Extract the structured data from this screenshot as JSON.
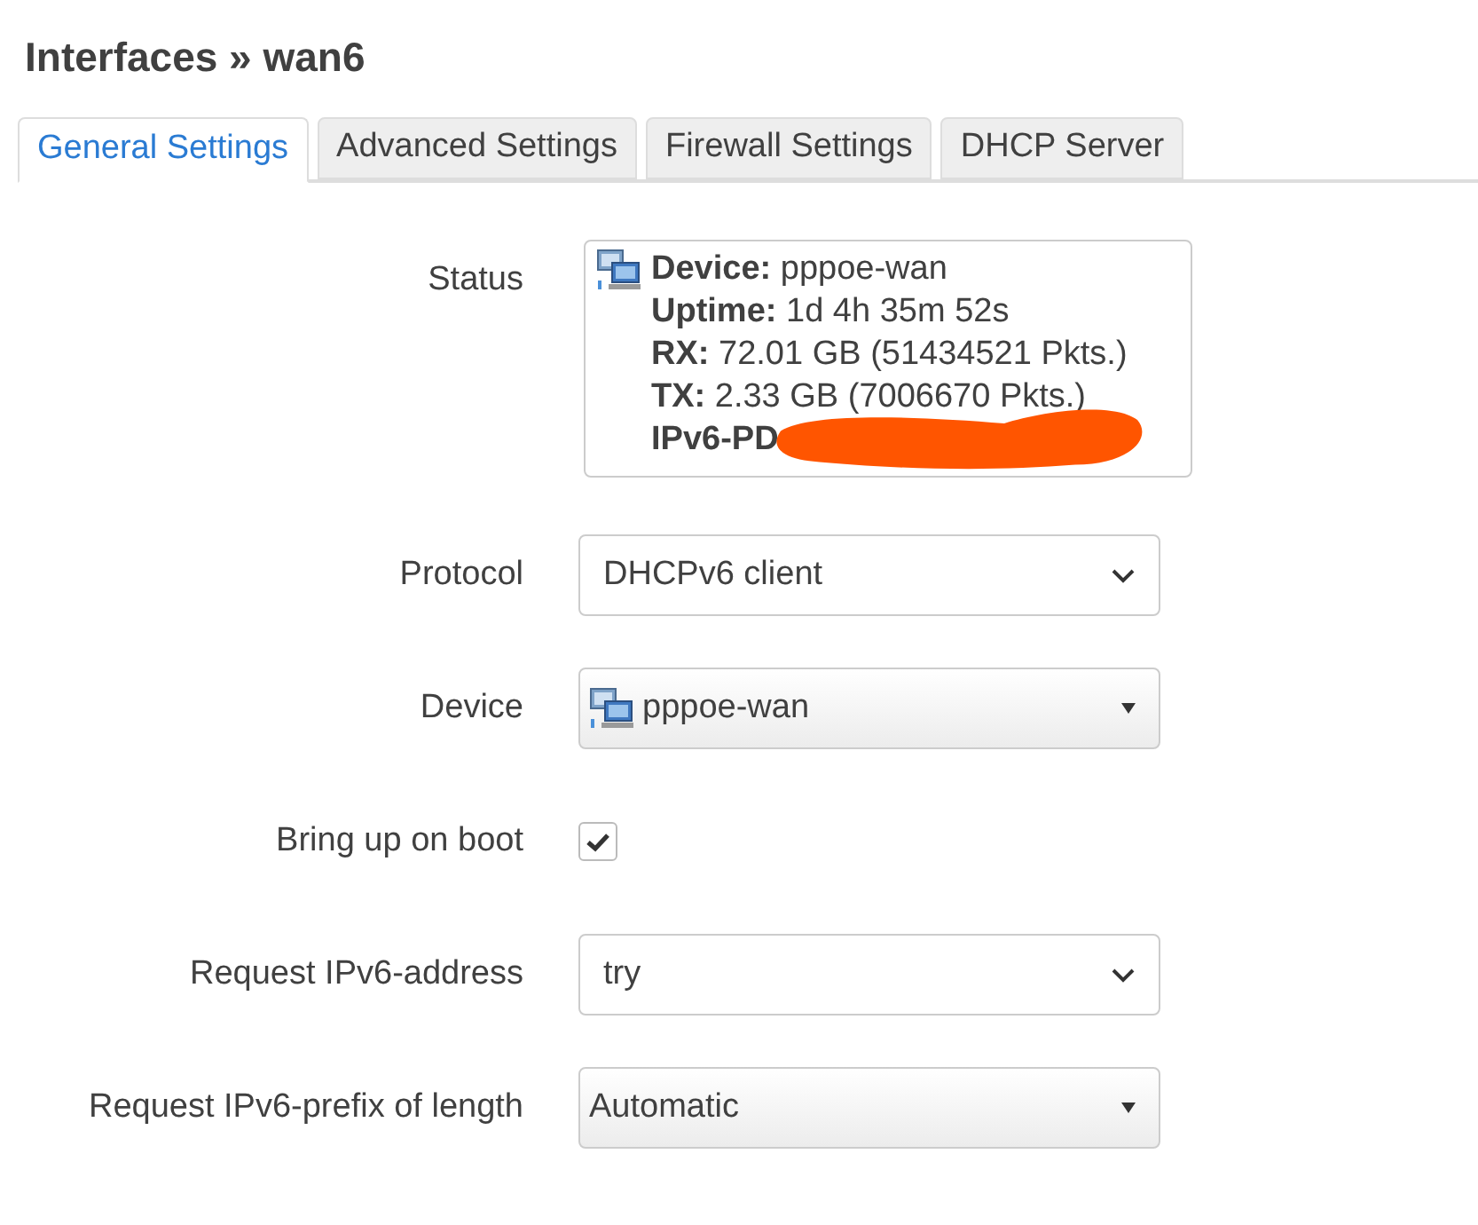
{
  "title": "Interfaces » wan6",
  "tabs": [
    {
      "label": "General Settings",
      "selected": true
    },
    {
      "label": "Advanced Settings",
      "selected": false
    },
    {
      "label": "Firewall Settings",
      "selected": false
    },
    {
      "label": "DHCP Server",
      "selected": false
    }
  ],
  "status": {
    "label": "Status",
    "lines": [
      {
        "label": "Device:",
        "value": "pppoe-wan"
      },
      {
        "label": "Uptime:",
        "value": "1d 4h 35m 52s"
      },
      {
        "label": "RX:",
        "value": "72.01 GB (51434521 Pkts.)"
      },
      {
        "label": "TX:",
        "value": "2.33 GB (7006670 Pkts.)"
      },
      {
        "label": "IPv6-PD"
      }
    ],
    "redacted": true
  },
  "fields": [
    {
      "label": "Protocol",
      "kind": "select",
      "value": "DHCPv6 client"
    },
    {
      "label": "Device",
      "kind": "dropdown",
      "value": "pppoe-wan",
      "device_icon": true
    },
    {
      "label": "Bring up on boot",
      "kind": "checkbox",
      "checked": true
    },
    {
      "label": "Request IPv6-address",
      "kind": "select",
      "value": "try"
    },
    {
      "label": "Request IPv6-prefix of length",
      "kind": "dropdown",
      "value": "Automatic",
      "device_icon": false
    }
  ]
}
